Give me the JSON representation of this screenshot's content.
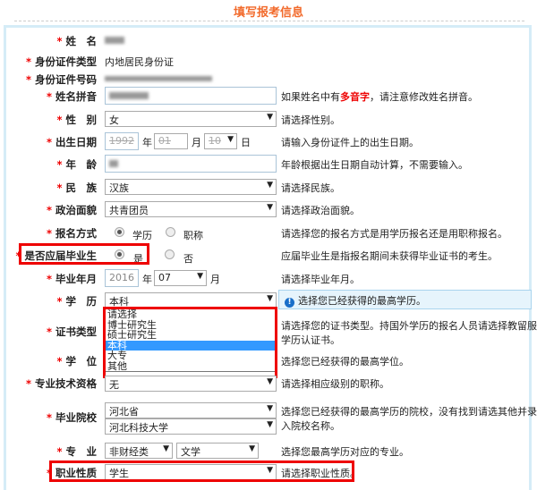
{
  "title": "填写报考信息",
  "fields": {
    "name": {
      "label": "姓　名"
    },
    "id_type": {
      "label": "身份证件类型",
      "value": "内地居民身份证"
    },
    "id_number": {
      "label": "身份证件号码"
    },
    "pinyin": {
      "label": "姓名拼音",
      "hint_pre": "如果姓名中有",
      "hint_em": "多音字",
      "hint_post": "，请注意修改姓名拼音。"
    },
    "gender": {
      "label": "性　别",
      "value": "女",
      "hint": "请选择性别。"
    },
    "birth": {
      "label": "出生日期",
      "year": "1992",
      "year_unit": "年",
      "month": "01",
      "month_unit": "月",
      "day": "10",
      "day_unit": "日",
      "hint": "请输入身份证件上的出生日期。"
    },
    "age": {
      "label": "年　龄",
      "hint": "年龄根据出生日期自动计算，不需要输入。"
    },
    "ethnicity": {
      "label": "民　族",
      "value": "汉族",
      "hint": "请选择民族。"
    },
    "politics": {
      "label": "政治面貌",
      "value": "共青团员",
      "hint": "请选择政治面貌。"
    },
    "apply_mode": {
      "label": "报名方式",
      "opt1": "学历",
      "opt2": "职称",
      "hint": "请选择您的报名方式是用学历报名还是用职称报名。"
    },
    "fresh_grad": {
      "label": "是否应届毕业生",
      "opt1": "是",
      "opt2": "否",
      "hint": "应届毕业生是指报名期间未获得毕业证书的考生。"
    },
    "grad_date": {
      "label": "毕业年月",
      "year": "2016",
      "year_unit": "年",
      "month": "07",
      "month_unit": "月",
      "hint": "请选择毕业年月。"
    },
    "education": {
      "label": "学　历",
      "value": "本科",
      "info": "选择您已经获得的最高学历。",
      "options": [
        "请选择",
        "博士研究生",
        "硕士研究生",
        "本科",
        "大专",
        "其他"
      ]
    },
    "cert_type": {
      "label": "证书类型",
      "hint1": "请选择您的证书类型。持国外学历的报名人员请选择教留服",
      "hint2": "学历认证书。"
    },
    "degree": {
      "label": "学　位",
      "hint": "选择您已经获得的最高学位。"
    },
    "tech_qual": {
      "label": "专业技术资格",
      "value": "无",
      "hint": "请选择相应级别的职称。"
    },
    "school": {
      "label": "毕业院校",
      "province": "河北省",
      "school": "河北科技大学",
      "hint1": "选择您已经获得的最高学历的院校，没有找到请选其他并录",
      "hint2": "入院校名称。"
    },
    "major": {
      "label": "专　业",
      "category": "非财经类",
      "subject": "文学",
      "hint": "选择您最高学历对应的专业。"
    },
    "occupation": {
      "label": "职业性质",
      "value": "学生",
      "hint": "请选择职业性质。"
    }
  },
  "star": "*",
  "arrow": "▼",
  "info_icon": "!"
}
